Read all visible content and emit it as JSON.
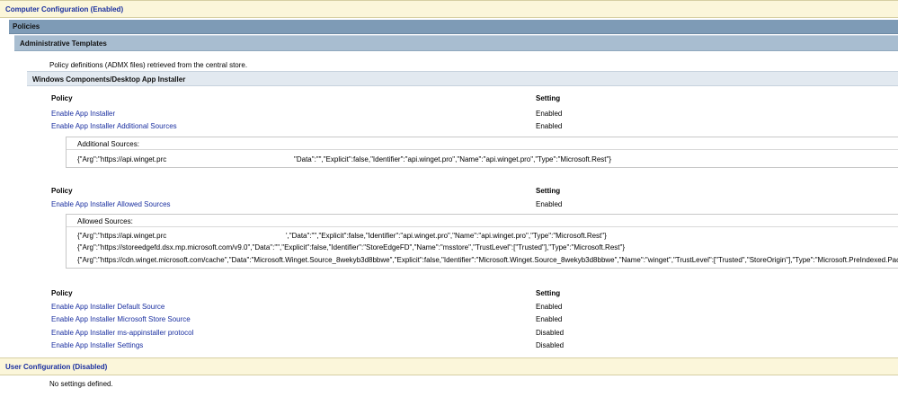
{
  "computer_config": {
    "title": "Computer Configuration (Enabled)"
  },
  "policies": {
    "title": "Policies"
  },
  "admin_templates": {
    "title": "Administrative Templates",
    "note": "Policy definitions (ADMX files) retrieved from the central store."
  },
  "category": {
    "title": "Windows Components/Desktop App Installer"
  },
  "columns": {
    "policy": "Policy",
    "setting": "Setting"
  },
  "group1": {
    "rows": [
      {
        "policy": "Enable App Installer",
        "setting": "Enabled"
      },
      {
        "policy": "Enable App Installer Additional Sources",
        "setting": "Enabled"
      }
    ],
    "box_title": "Additional Sources:",
    "box_lines": [
      {
        "left": "{\"Arg\":\"https://api.winget.prc",
        "right": "\"Data\":\"\",\"Explicit\":false,\"Identifier\":\"api.winget.pro\",\"Name\":\"api.winget.pro\",\"Type\":\"Microsoft.Rest\"}"
      }
    ]
  },
  "group2": {
    "rows": [
      {
        "policy": "Enable App Installer Allowed Sources",
        "setting": "Enabled"
      }
    ],
    "box_title": "Allowed Sources:",
    "box_lines": [
      {
        "left": "{\"Arg\":\"https://api.winget.prc",
        "right": "',\"Data\":\"\",\"Explicit\":false,\"Identifier\":\"api.winget.pro\",\"Name\":\"api.winget.pro\",\"Type\":\"Microsoft.Rest\"}"
      },
      {
        "full": "{\"Arg\":\"https://storeedgefd.dsx.mp.microsoft.com/v9.0\",\"Data\":\"\",\"Explicit\":false,\"Identifier\":\"StoreEdgeFD\",\"Name\":\"msstore\",\"TrustLevel\":[\"Trusted\"],\"Type\":\"Microsoft.Rest\"}"
      },
      {
        "full": "{\"Arg\":\"https://cdn.winget.microsoft.com/cache\",\"Data\":\"Microsoft.Winget.Source_8wekyb3d8bbwe\",\"Explicit\":false,\"Identifier\":\"Microsoft.Winget.Source_8wekyb3d8bbwe\",\"Name\":\"winget\",\"TrustLevel\":[\"Trusted\",\"StoreOrigin\"],\"Type\":\"Microsoft.PreIndexed.Package\"}"
      }
    ]
  },
  "group3": {
    "rows": [
      {
        "policy": "Enable App Installer Default Source",
        "setting": "Enabled"
      },
      {
        "policy": "Enable App Installer Microsoft Store Source",
        "setting": "Enabled"
      },
      {
        "policy": "Enable App Installer ms-appinstaller protocol",
        "setting": "Disabled"
      },
      {
        "policy": "Enable App Installer Settings",
        "setting": "Disabled"
      }
    ]
  },
  "user_config": {
    "title": "User Configuration (Disabled)",
    "note": "No settings defined."
  }
}
